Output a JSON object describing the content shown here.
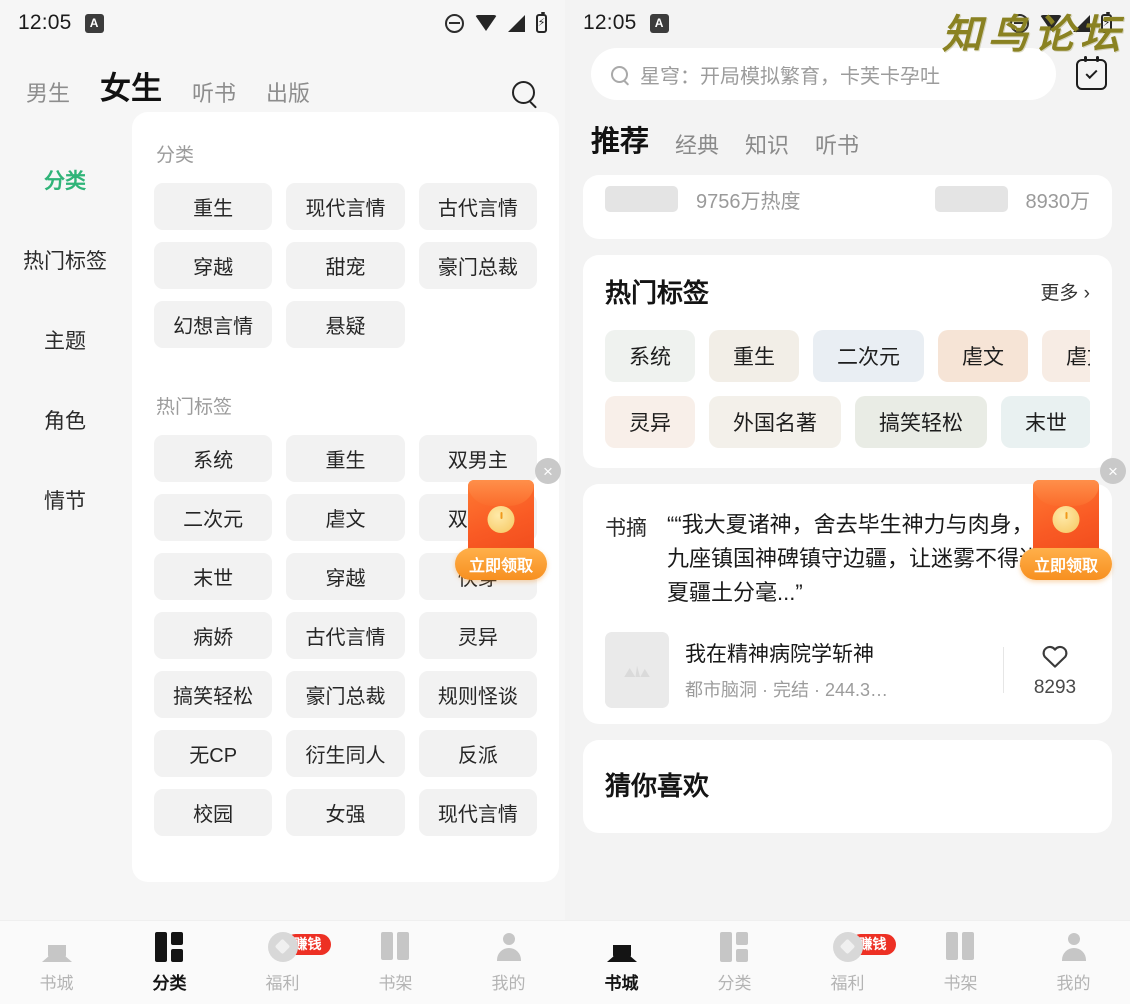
{
  "status_bar": {
    "time": "12:05",
    "app_icon_letter": "A",
    "icons": [
      "mute-icon",
      "wifi-icon",
      "signal-icon",
      "battery-icon"
    ]
  },
  "watermark": {
    "text": "知鸟论坛",
    "color": "#8a8222"
  },
  "left_pane": {
    "top_tabs": [
      {
        "label": "男生",
        "active": false
      },
      {
        "label": "女生",
        "active": true
      },
      {
        "label": "听书",
        "active": false
      },
      {
        "label": "出版",
        "active": false
      }
    ],
    "search_icon": "search-icon",
    "sidebar": {
      "items": [
        {
          "label": "分类",
          "active": true
        },
        {
          "label": "热门标签",
          "active": false
        },
        {
          "label": "主题",
          "active": false
        },
        {
          "label": "角色",
          "active": false
        },
        {
          "label": "情节",
          "active": false
        }
      ],
      "active_color": "#2fb478"
    },
    "sections": [
      {
        "title": "分类",
        "chips": [
          "重生",
          "现代言情",
          "古代言情",
          "穿越",
          "甜宠",
          "豪门总裁",
          "幻想言情",
          "悬疑"
        ]
      },
      {
        "title": "热门标签",
        "chips": [
          "系统",
          "重生",
          "双男主",
          "二次元",
          "虐文",
          "双女主",
          "末世",
          "穿越",
          "快穿",
          "病娇",
          "古代言情",
          "灵异",
          "搞笑轻松",
          "豪门总裁",
          "规则怪谈",
          "无CP",
          "衍生同人",
          "反派",
          "校园",
          "女强",
          "现代言情"
        ]
      }
    ],
    "red_packet": {
      "button_label": "立即领取",
      "close_label": "×",
      "packet_color": "#f95a24",
      "button_color": "#f79020"
    },
    "bottom_nav": [
      {
        "label": "书城",
        "icon": "home-icon",
        "active": false,
        "badge": ""
      },
      {
        "label": "分类",
        "icon": "grid-icon",
        "active": true,
        "badge": ""
      },
      {
        "label": "福利",
        "icon": "coin-icon",
        "active": false,
        "badge": "赚钱"
      },
      {
        "label": "书架",
        "icon": "book-icon",
        "active": false,
        "badge": ""
      },
      {
        "label": "我的",
        "icon": "person-icon",
        "active": false,
        "badge": ""
      }
    ]
  },
  "right_pane": {
    "search": {
      "placeholder": "星穹：开局模拟繁育，卡芙卡孕吐",
      "icon": "search-icon",
      "value": ""
    },
    "calendar_icon": "calendar-check-icon",
    "tabs": [
      {
        "label": "推荐",
        "active": true
      },
      {
        "label": "经典",
        "active": false
      },
      {
        "label": "知识",
        "active": false
      },
      {
        "label": "听书",
        "active": false
      }
    ],
    "partial_card": {
      "left_heat": "9756万热度",
      "right_heat": "8930万"
    },
    "hot_tags_card": {
      "title": "热门标签",
      "more_label": "更多 ›",
      "rows": [
        [
          {
            "label": "系统",
            "bg": "#eff2ef"
          },
          {
            "label": "重生",
            "bg": "#f2eee7"
          },
          {
            "label": "二次元",
            "bg": "#e9eef3"
          },
          {
            "label": "虐文",
            "bg": "#f6e4d6"
          },
          {
            "label": "虐文",
            "bg": "#f7ece4"
          }
        ],
        [
          {
            "label": "灵异",
            "bg": "#f8efe9"
          },
          {
            "label": "外国名著",
            "bg": "#f3f0ea"
          },
          {
            "label": "搞笑轻松",
            "bg": "#e9ece5"
          },
          {
            "label": "末世",
            "bg": "#e9f1f1"
          }
        ]
      ]
    },
    "quote_card": {
      "label": "书摘",
      "text": "““我大夏诸神，舍去毕生神力与肉身，化作九座镇国神碑镇守边疆，让迷雾不得进我大夏疆土分毫...”",
      "book": {
        "title": "我在精神病院学斩神",
        "meta": "都市脑洞 · 完结 · 244.3…",
        "like_icon": "heart-icon",
        "like_count": "8293"
      }
    },
    "guess_card": {
      "title": "猜你喜欢"
    },
    "red_packet": {
      "button_label": "立即领取",
      "close_label": "×"
    },
    "bottom_nav": [
      {
        "label": "书城",
        "icon": "home-icon",
        "active": true,
        "badge": ""
      },
      {
        "label": "分类",
        "icon": "grid-icon",
        "active": false,
        "badge": ""
      },
      {
        "label": "福利",
        "icon": "coin-icon",
        "active": false,
        "badge": "赚钱"
      },
      {
        "label": "书架",
        "icon": "book-icon",
        "active": false,
        "badge": ""
      },
      {
        "label": "我的",
        "icon": "person-icon",
        "active": false,
        "badge": ""
      }
    ]
  }
}
